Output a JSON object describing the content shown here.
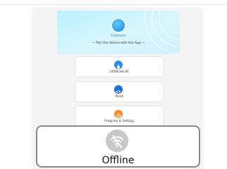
{
  "header": {
    "connect_label": "Connect",
    "pair_hint": "--- Pair the device with the App ---"
  },
  "cards": [
    {
      "label": "UVSR(Ver.8)",
      "icon": "drop-icon",
      "color": "#2a8fe6"
    },
    {
      "label": "Read",
      "icon": "eye-icon",
      "color": "#1e6fd6"
    },
    {
      "label": "Program & Setting",
      "icon": "gear-icon",
      "color": "#ff8a2b"
    }
  ],
  "status": {
    "label": "Offline",
    "icon": "wifi-off-icon"
  }
}
